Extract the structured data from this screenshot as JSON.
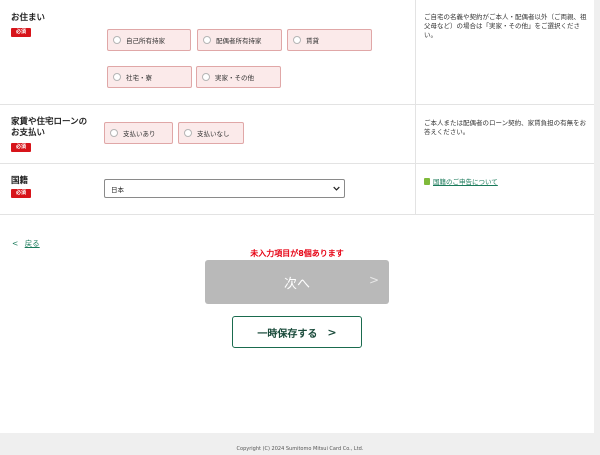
{
  "housing": {
    "label": "お住まい",
    "required": "必須",
    "options": [
      "自己所有持家",
      "配偶者所有持家",
      "賃貸",
      "社宅・寮",
      "実家・その他"
    ],
    "note": "ご自宅の名義や契約がご本人・配偶者以外（ご両親、祖父母など）の場合は「実家・その他」をご選択ください。"
  },
  "payment": {
    "label_line1": "家賃や住宅ローンの",
    "label_line2": "お支払い",
    "required": "必須",
    "options": [
      "支払いあり",
      "支払いなし"
    ],
    "note": "ご本人または配偶者のローン契約、家賃負担の有無をお答えください。"
  },
  "nationality": {
    "label": "国籍",
    "required": "必須",
    "selected": "日本",
    "link": "国籍のご申告について"
  },
  "nav": {
    "back_arrow": "<",
    "back": "戻る",
    "error": "未入力項目が8個あります",
    "next": "次へ",
    "next_arrow": ">",
    "save": "一時保存する",
    "save_arrow": ">"
  },
  "footer": {
    "copyright": "Copyright (C) 2024 Sumitomo Mitsui Card Co., Ltd."
  },
  "colors": {
    "required_badge": "#d7141a",
    "option_bg": "#fbeaea",
    "option_border": "#e0a7a7",
    "link": "#1a7a5a",
    "error": "#e60012",
    "next_disabled": "#b9b9b9",
    "save_border": "#1a6b4e"
  }
}
